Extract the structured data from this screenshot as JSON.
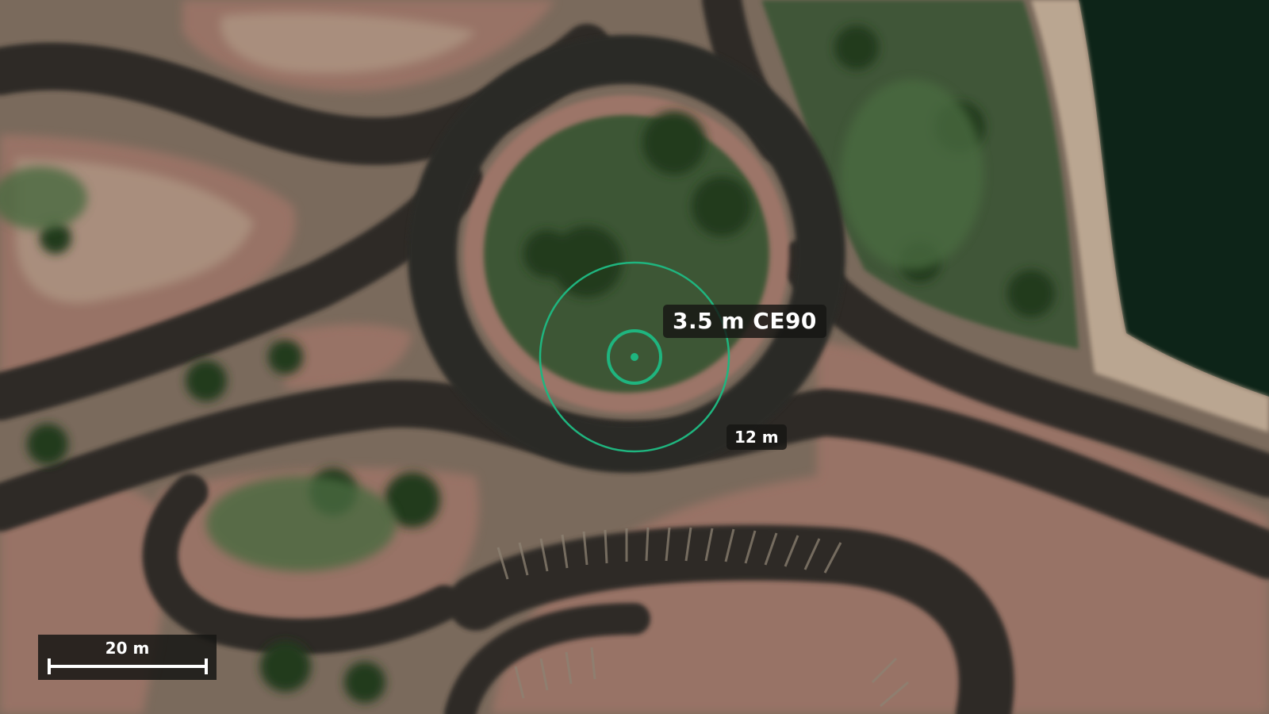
{
  "map": {
    "type": "satellite-imagery",
    "subject": "roundabout"
  },
  "accuracy": {
    "ce90_label": "3.5 m CE90",
    "ce90_meters": 3.5,
    "radius_label": "12 m",
    "radius_meters": 12,
    "ring_color": "#1fb57f"
  },
  "scale": {
    "label": "20 m",
    "meters": 20
  }
}
